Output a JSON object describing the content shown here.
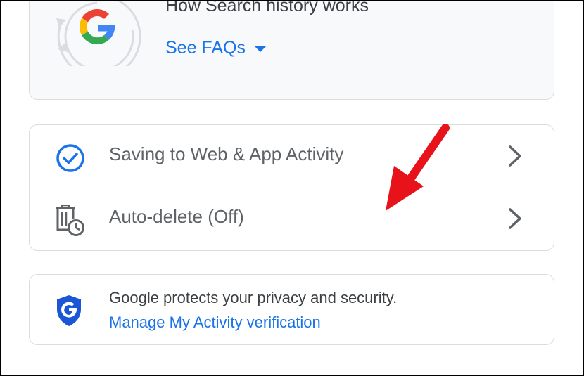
{
  "faq_card": {
    "title": "How Search history works",
    "link_label": "See FAQs",
    "icons": {
      "logo": "google-g-logo",
      "caret": "caret-down-icon"
    }
  },
  "settings": {
    "items": [
      {
        "label": "Saving to Web & App Activity",
        "icon": "check-circle-icon",
        "trailing_icon": "chevron-right-icon"
      },
      {
        "label": "Auto-delete (Off)",
        "icon": "trash-clock-icon",
        "trailing_icon": "chevron-right-icon"
      }
    ]
  },
  "privacy": {
    "text": "Google protects your privacy and security.",
    "link_label": "Manage My Activity verification",
    "icon": "google-shield-icon"
  },
  "annotation": {
    "icon": "red-arrow-annotation"
  },
  "colors": {
    "link_blue": "#1a73e8",
    "card_bg": "#f8f9fa",
    "border": "#dadce0",
    "label_grey": "#5f6368",
    "annotation_red": "#e8121b"
  }
}
